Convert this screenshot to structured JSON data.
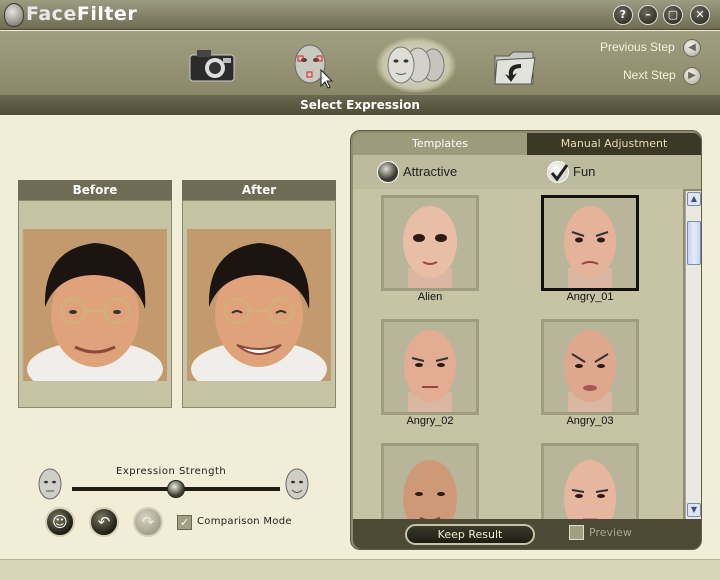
{
  "app": {
    "title_part1": "Face",
    "title_part2": "Filter"
  },
  "window_buttons": [
    {
      "name": "help",
      "glyph": "?"
    },
    {
      "name": "minimize",
      "glyph": "–"
    },
    {
      "name": "restore",
      "glyph": "▢"
    },
    {
      "name": "close",
      "glyph": "✕"
    }
  ],
  "steps": [
    {
      "name": "camera-icon"
    },
    {
      "name": "face-points-icon"
    },
    {
      "name": "faces-expression-icon",
      "current": true
    },
    {
      "name": "save-folder-icon"
    }
  ],
  "nav": {
    "previous": "Previous Step",
    "next": "Next Step"
  },
  "section_title": "Select Expression",
  "before_panel": {
    "title": "Before"
  },
  "after_panel": {
    "title": "After"
  },
  "tabs": {
    "templates": "Templates",
    "manual": "Manual Adjustment"
  },
  "categories": {
    "attractive": "Attractive",
    "fun": "Fun",
    "selected": "Fun"
  },
  "templates": [
    {
      "label": "Alien"
    },
    {
      "label": "Angry_01",
      "selected": true
    },
    {
      "label": "Angry_02"
    },
    {
      "label": "Angry_03"
    },
    {
      "label": ""
    },
    {
      "label": ""
    }
  ],
  "controls": {
    "strength_label": "Expression Strength",
    "strength_value": 0.5,
    "comparison_label": "Comparison Mode",
    "comparison_checked": true,
    "keep_result": "Keep Result",
    "preview_label": "Preview",
    "preview_checked": false
  },
  "colors": {
    "accent": "#6e6c55",
    "selection": "#111111",
    "background": "#f1edd6"
  }
}
